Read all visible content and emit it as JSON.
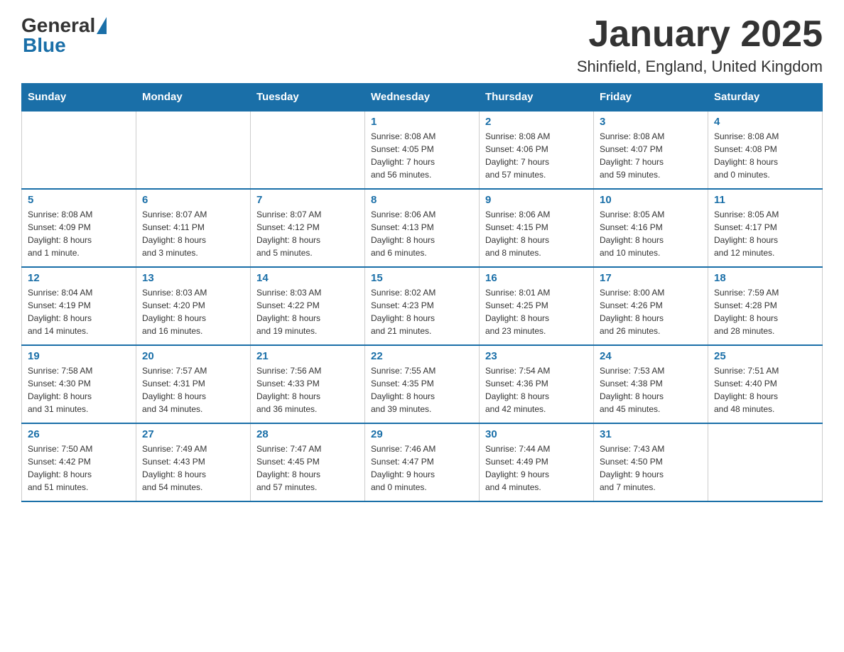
{
  "logo": {
    "general": "General",
    "blue": "Blue"
  },
  "title": "January 2025",
  "subtitle": "Shinfield, England, United Kingdom",
  "weekdays": [
    "Sunday",
    "Monday",
    "Tuesday",
    "Wednesday",
    "Thursday",
    "Friday",
    "Saturday"
  ],
  "weeks": [
    [
      {
        "day": "",
        "info": ""
      },
      {
        "day": "",
        "info": ""
      },
      {
        "day": "",
        "info": ""
      },
      {
        "day": "1",
        "info": "Sunrise: 8:08 AM\nSunset: 4:05 PM\nDaylight: 7 hours\nand 56 minutes."
      },
      {
        "day": "2",
        "info": "Sunrise: 8:08 AM\nSunset: 4:06 PM\nDaylight: 7 hours\nand 57 minutes."
      },
      {
        "day": "3",
        "info": "Sunrise: 8:08 AM\nSunset: 4:07 PM\nDaylight: 7 hours\nand 59 minutes."
      },
      {
        "day": "4",
        "info": "Sunrise: 8:08 AM\nSunset: 4:08 PM\nDaylight: 8 hours\nand 0 minutes."
      }
    ],
    [
      {
        "day": "5",
        "info": "Sunrise: 8:08 AM\nSunset: 4:09 PM\nDaylight: 8 hours\nand 1 minute."
      },
      {
        "day": "6",
        "info": "Sunrise: 8:07 AM\nSunset: 4:11 PM\nDaylight: 8 hours\nand 3 minutes."
      },
      {
        "day": "7",
        "info": "Sunrise: 8:07 AM\nSunset: 4:12 PM\nDaylight: 8 hours\nand 5 minutes."
      },
      {
        "day": "8",
        "info": "Sunrise: 8:06 AM\nSunset: 4:13 PM\nDaylight: 8 hours\nand 6 minutes."
      },
      {
        "day": "9",
        "info": "Sunrise: 8:06 AM\nSunset: 4:15 PM\nDaylight: 8 hours\nand 8 minutes."
      },
      {
        "day": "10",
        "info": "Sunrise: 8:05 AM\nSunset: 4:16 PM\nDaylight: 8 hours\nand 10 minutes."
      },
      {
        "day": "11",
        "info": "Sunrise: 8:05 AM\nSunset: 4:17 PM\nDaylight: 8 hours\nand 12 minutes."
      }
    ],
    [
      {
        "day": "12",
        "info": "Sunrise: 8:04 AM\nSunset: 4:19 PM\nDaylight: 8 hours\nand 14 minutes."
      },
      {
        "day": "13",
        "info": "Sunrise: 8:03 AM\nSunset: 4:20 PM\nDaylight: 8 hours\nand 16 minutes."
      },
      {
        "day": "14",
        "info": "Sunrise: 8:03 AM\nSunset: 4:22 PM\nDaylight: 8 hours\nand 19 minutes."
      },
      {
        "day": "15",
        "info": "Sunrise: 8:02 AM\nSunset: 4:23 PM\nDaylight: 8 hours\nand 21 minutes."
      },
      {
        "day": "16",
        "info": "Sunrise: 8:01 AM\nSunset: 4:25 PM\nDaylight: 8 hours\nand 23 minutes."
      },
      {
        "day": "17",
        "info": "Sunrise: 8:00 AM\nSunset: 4:26 PM\nDaylight: 8 hours\nand 26 minutes."
      },
      {
        "day": "18",
        "info": "Sunrise: 7:59 AM\nSunset: 4:28 PM\nDaylight: 8 hours\nand 28 minutes."
      }
    ],
    [
      {
        "day": "19",
        "info": "Sunrise: 7:58 AM\nSunset: 4:30 PM\nDaylight: 8 hours\nand 31 minutes."
      },
      {
        "day": "20",
        "info": "Sunrise: 7:57 AM\nSunset: 4:31 PM\nDaylight: 8 hours\nand 34 minutes."
      },
      {
        "day": "21",
        "info": "Sunrise: 7:56 AM\nSunset: 4:33 PM\nDaylight: 8 hours\nand 36 minutes."
      },
      {
        "day": "22",
        "info": "Sunrise: 7:55 AM\nSunset: 4:35 PM\nDaylight: 8 hours\nand 39 minutes."
      },
      {
        "day": "23",
        "info": "Sunrise: 7:54 AM\nSunset: 4:36 PM\nDaylight: 8 hours\nand 42 minutes."
      },
      {
        "day": "24",
        "info": "Sunrise: 7:53 AM\nSunset: 4:38 PM\nDaylight: 8 hours\nand 45 minutes."
      },
      {
        "day": "25",
        "info": "Sunrise: 7:51 AM\nSunset: 4:40 PM\nDaylight: 8 hours\nand 48 minutes."
      }
    ],
    [
      {
        "day": "26",
        "info": "Sunrise: 7:50 AM\nSunset: 4:42 PM\nDaylight: 8 hours\nand 51 minutes."
      },
      {
        "day": "27",
        "info": "Sunrise: 7:49 AM\nSunset: 4:43 PM\nDaylight: 8 hours\nand 54 minutes."
      },
      {
        "day": "28",
        "info": "Sunrise: 7:47 AM\nSunset: 4:45 PM\nDaylight: 8 hours\nand 57 minutes."
      },
      {
        "day": "29",
        "info": "Sunrise: 7:46 AM\nSunset: 4:47 PM\nDaylight: 9 hours\nand 0 minutes."
      },
      {
        "day": "30",
        "info": "Sunrise: 7:44 AM\nSunset: 4:49 PM\nDaylight: 9 hours\nand 4 minutes."
      },
      {
        "day": "31",
        "info": "Sunrise: 7:43 AM\nSunset: 4:50 PM\nDaylight: 9 hours\nand 7 minutes."
      },
      {
        "day": "",
        "info": ""
      }
    ]
  ]
}
